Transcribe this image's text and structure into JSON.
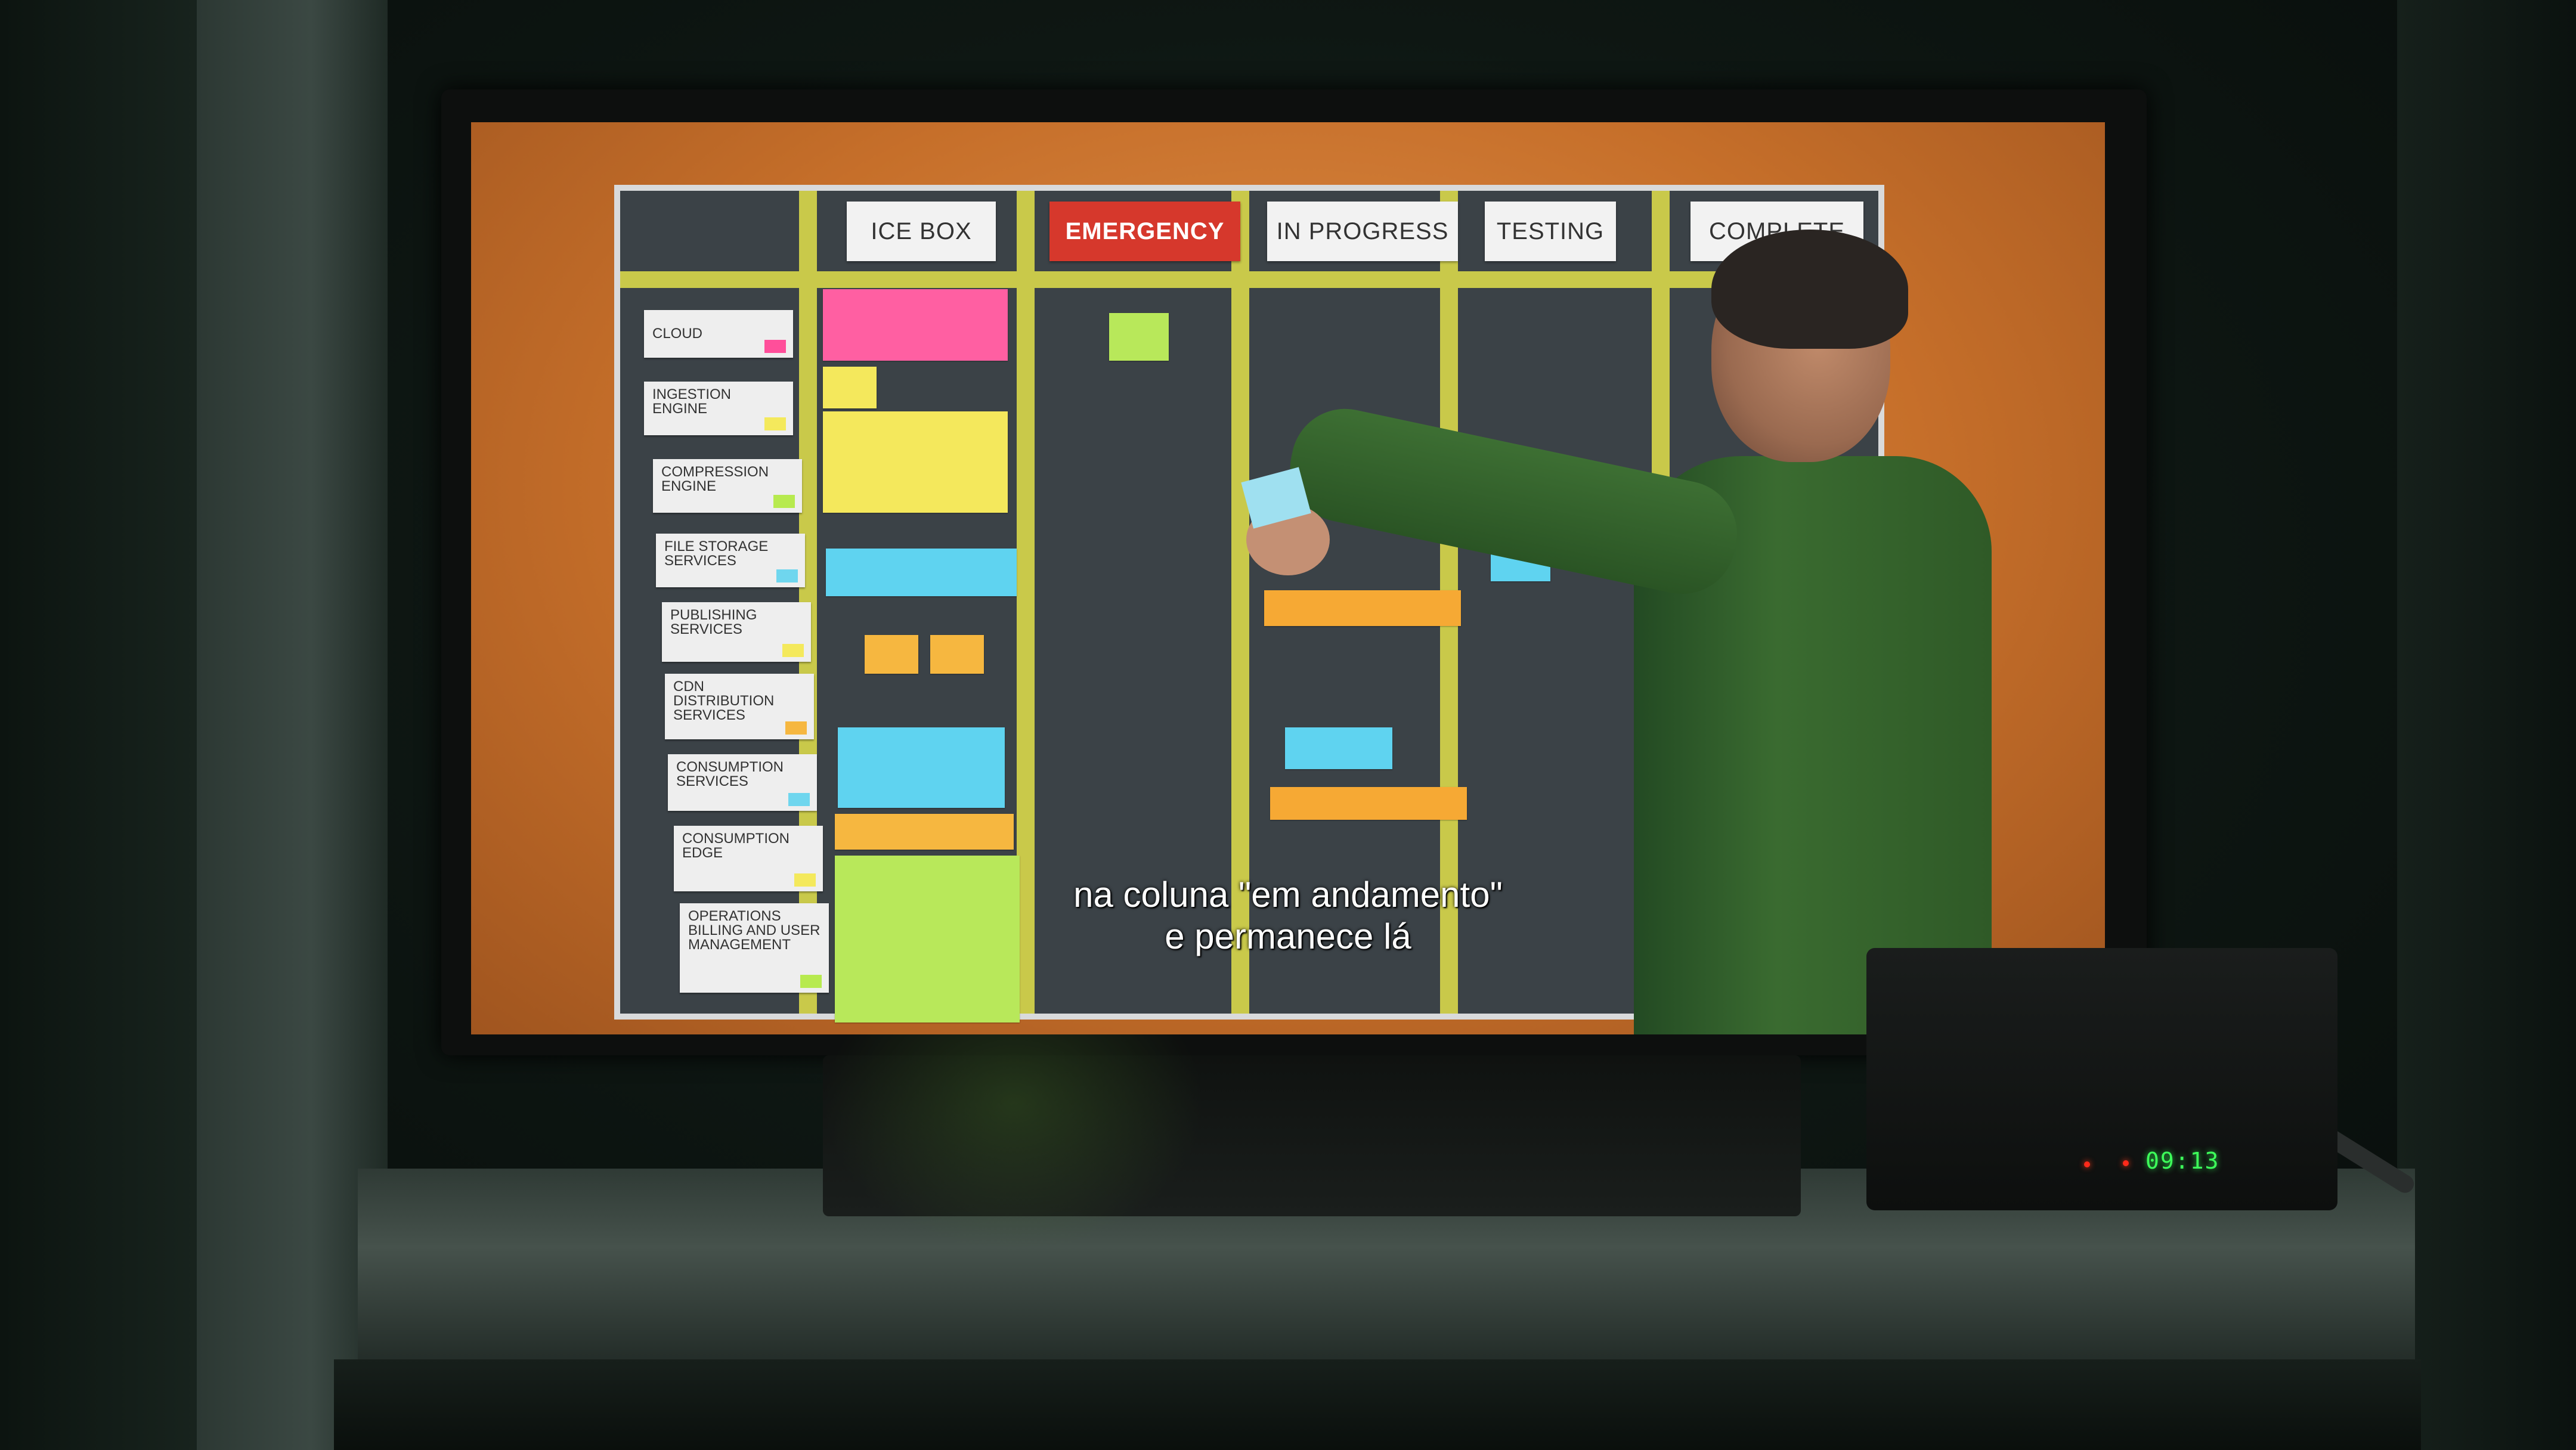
{
  "board": {
    "columns": [
      {
        "label": "ICE BOX"
      },
      {
        "label": "EMERGENCY"
      },
      {
        "label": "IN PROGRESS"
      },
      {
        "label": "TESTING"
      },
      {
        "label": "COMPLETE"
      }
    ],
    "lanes": [
      {
        "label": "CLOUD",
        "chip": "#ff4f9a"
      },
      {
        "label": "INGESTION ENGINE",
        "chip": "#f4e95c"
      },
      {
        "label": "COMPRESSION ENGINE",
        "chip": "#b7ea4f"
      },
      {
        "label": "FILE STORAGE SERVICES",
        "chip": "#6fd6ee"
      },
      {
        "label": "PUBLISHING SERVICES",
        "chip": "#f4e95c"
      },
      {
        "label": "CDN DISTRIBUTION SERVICES",
        "chip": "#f6b740"
      },
      {
        "label": "CONSUMPTION SERVICES",
        "chip": "#6fd6ee"
      },
      {
        "label": "CONSUMPTION EDGE",
        "chip": "#f4e95c"
      },
      {
        "label": "OPERATIONS BILLING AND USER MANAGEMENT",
        "chip": "#b7ea4f"
      }
    ]
  },
  "subtitle": {
    "line1": "na coluna \"em andamento\"",
    "line2": "e permanece lá"
  },
  "set_top_box": {
    "clock": "09:13"
  },
  "colors": {
    "pink": "#ff5fa2",
    "yellow": "#f4e85c",
    "cyan": "#5fd3f0",
    "orange": "#f6a934",
    "green": "#b8e85a"
  }
}
